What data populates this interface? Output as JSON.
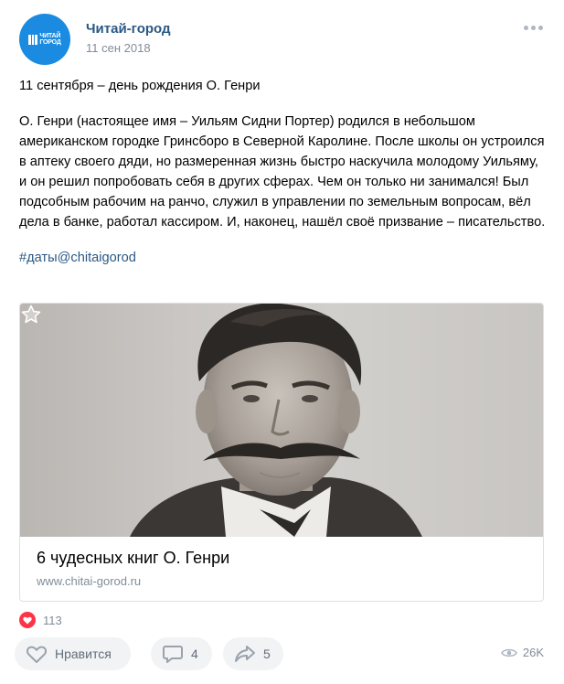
{
  "post": {
    "author": "Читай-город",
    "date": "11 сен 2018",
    "avatar_text_1": "ЧИТАЙ",
    "avatar_text_2": "ГОРОД",
    "text_line_1": "11 сентября – день рождения О. Генри",
    "text_paragraph": "О. Генри (настоящее имя – Уильям Сидни Портер) родился в небольшом американском городке Гринсборо в Северной Каролине. После школы он устроился в аптеку своего дяди, но размеренная жизнь быстро наскучила молодому Уильяму, и он решил попробовать себя в других сферах. Чем он только ни занимался! Был подсобным рабочим на ранчо, служил в управлении по земельным вопросам, вёл дела в банке, работал кассиром. И, наконец, нашёл своё призвание – писательство.",
    "hashtag": "#даты@chitaigorod"
  },
  "link_card": {
    "title": "6 чудесных книг О. Генри",
    "url": "www.chitai-gorod.ru",
    "image_icon": "portrait-photo"
  },
  "stats": {
    "likes_count": "113",
    "like_label": "Нравится",
    "comments_count": "4",
    "shares_count": "5",
    "views_count": "26K"
  },
  "colors": {
    "link": "#2a5885",
    "muted": "#818c99",
    "avatar_bg": "#1a8be0",
    "heart": "#ff3347",
    "button_bg": "#f2f3f5"
  }
}
